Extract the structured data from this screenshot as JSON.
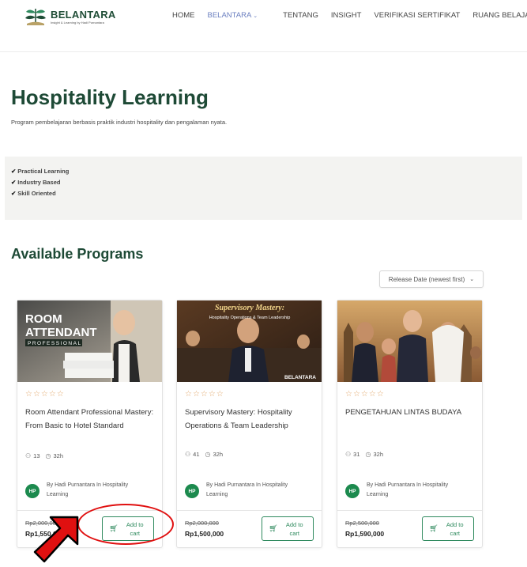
{
  "header": {
    "brand": "BELANTARA",
    "tagline": "Insight & Learning by Hadi Purnantara",
    "nav": [
      "HOME",
      "BELANTARA",
      "TENTANG",
      "INSIGHT",
      "VERIFIKASI SERTIFIKAT",
      "RUANG BELAJAR"
    ]
  },
  "hero": {
    "title": "Hospitality Learning",
    "description": "Program pembelajaran berbasis praktik industri hospitality dan pengalaman nyata.",
    "features": [
      "Practical Learning",
      "Industry Based",
      "Skill Oriented"
    ]
  },
  "programs": {
    "title": "Available Programs",
    "sort_label": "Release Date (newest first)",
    "cards": [
      {
        "image_label_1": "ROOM",
        "image_label_2": "ATTENDANT",
        "image_label_3": "PROFESSIONAL",
        "title": "Room Attendant Professional Mastery: From Basic to Hotel Standard",
        "students": "13",
        "duration": "32h",
        "author_initials": "HP",
        "author": "By Hadi Purnantara In Hospitality Learning",
        "old_price": "Rp2,000,000",
        "price": "Rp1,550,000",
        "cart_label": "Add to cart"
      },
      {
        "image_label_1": "Supervisory Mastery:",
        "image_label_2": "Hospitality Operations & Team Leadership",
        "image_label_3": "BELANTARA",
        "title": "Supervisory Mastery: Hospitality Operations & Team Leadership",
        "students": "41",
        "duration": "32h",
        "author_initials": "HP",
        "author": "By Hadi Purnantara In Hospitality Learning",
        "old_price": "Rp2,000,000",
        "price": "Rp1,500,000",
        "cart_label": "Add to cart"
      },
      {
        "title": "PENGETAHUAN LINTAS BUDAYA",
        "students": "31",
        "duration": "32h",
        "author_initials": "HP",
        "author": "By Hadi Purnantara In Hospitality Learning",
        "old_price": "Rp2,500,000",
        "price": "Rp1,590,000",
        "cart_label": "Add to cart"
      }
    ]
  },
  "colors": {
    "brand_green": "#1e4a36",
    "button_green": "#2f8a5e",
    "avatar_green": "#1c8a4e",
    "star": "#e2a76a",
    "annotation_red": "#e01010"
  }
}
